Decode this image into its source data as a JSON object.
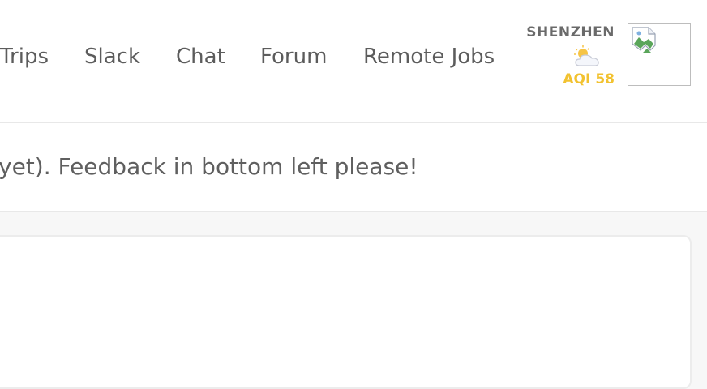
{
  "nav": {
    "items": [
      {
        "label": "Trips"
      },
      {
        "label": "Slack"
      },
      {
        "label": "Chat"
      },
      {
        "label": "Forum"
      },
      {
        "label": "Remote Jobs"
      }
    ]
  },
  "location": {
    "city": "SHENZHEN",
    "weather_icon": "partly-cloudy-icon",
    "aqi_label": "AQI",
    "aqi_value": "58",
    "aqi_color": "#f2c230"
  },
  "avatar": {
    "icon": "broken-image-icon"
  },
  "notice": {
    "text": "yet). Feedback in bottom left please!"
  }
}
